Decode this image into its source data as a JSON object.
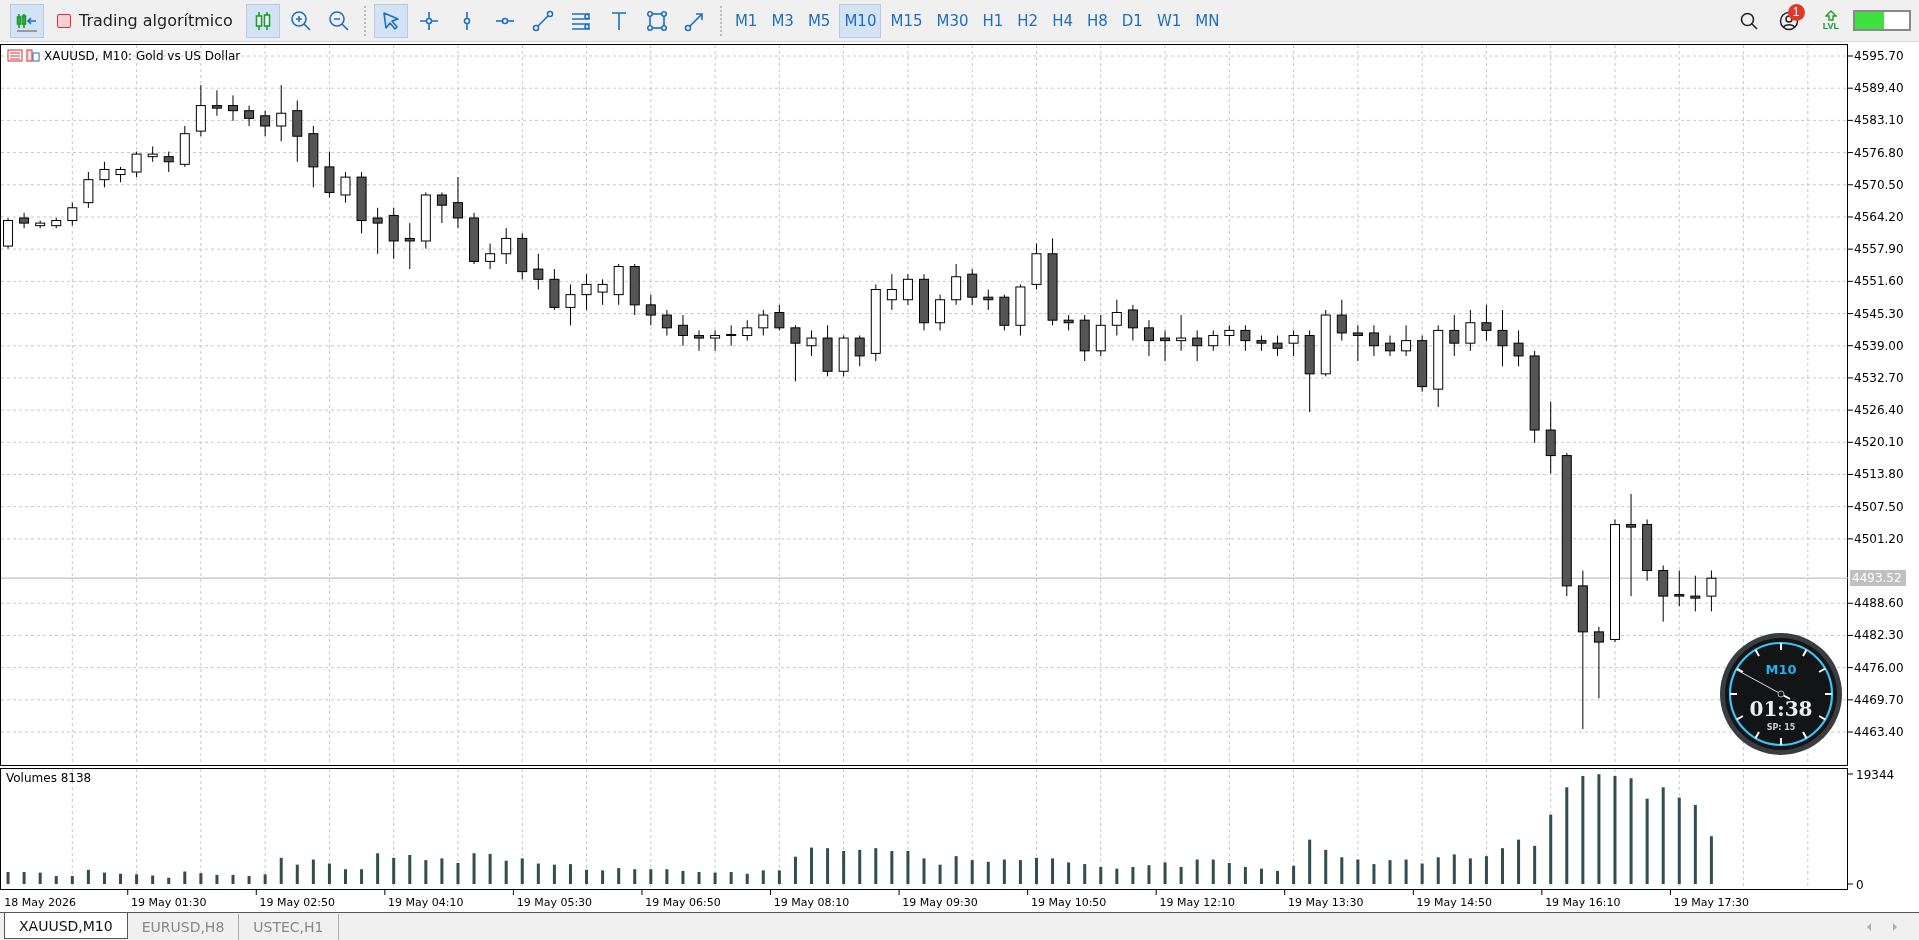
{
  "toolbar": {
    "tool_groups": [
      [
        {
          "kind": "shift",
          "selected": true
        },
        {
          "kind": "algo",
          "label": "Trading algorítmico",
          "on": false,
          "selected": false
        },
        {
          "kind": "candles",
          "selected": true
        },
        {
          "kind": "zoom-in",
          "selected": false
        },
        {
          "kind": "zoom-out",
          "selected": false
        }
      ],
      [
        {
          "kind": "cursor",
          "selected": true
        },
        {
          "kind": "crosshair",
          "selected": false
        },
        {
          "kind": "vline",
          "selected": false
        },
        {
          "kind": "hline",
          "selected": false
        },
        {
          "kind": "trendline",
          "selected": false
        },
        {
          "kind": "channels",
          "selected": false
        },
        {
          "kind": "text",
          "selected": false
        },
        {
          "kind": "rectangle",
          "selected": false
        },
        {
          "kind": "arrow",
          "selected": false
        }
      ]
    ],
    "timeframes": [
      {
        "label": "M1",
        "selected": false
      },
      {
        "label": "M3",
        "selected": false
      },
      {
        "label": "M5",
        "selected": false
      },
      {
        "label": "M10",
        "selected": true
      },
      {
        "label": "M15",
        "selected": false
      },
      {
        "label": "M30",
        "selected": false
      },
      {
        "label": "H1",
        "selected": false
      },
      {
        "label": "H2",
        "selected": false
      },
      {
        "label": "H4",
        "selected": false
      },
      {
        "label": "H8",
        "selected": false
      },
      {
        "label": "D1",
        "selected": false
      },
      {
        "label": "W1",
        "selected": false
      },
      {
        "label": "MN",
        "selected": false
      }
    ],
    "notifications_badge": "1",
    "level_indicator": {
      "label": "LVL",
      "level": 0.53
    }
  },
  "chart": {
    "title": "XAUUSD, M10: Gold vs US Dollar",
    "clock": {
      "timeframe": "M10",
      "countdown": "01:38",
      "spread": "SP: 15"
    },
    "chart_data": {
      "type": "candlestick",
      "grid": true,
      "ref_lines": [
        {
          "axis": "y",
          "value": 4493.52,
          "label": "4493.52"
        }
      ],
      "ylim": [
        4456.75,
        4598.05
      ],
      "yticks": [
        {
          "value": 4595.7,
          "label": "4595.70"
        },
        {
          "value": 4589.4,
          "label": "4589.40"
        },
        {
          "value": 4583.1,
          "label": "4583.10"
        },
        {
          "value": 4576.8,
          "label": "4576.80"
        },
        {
          "value": 4570.5,
          "label": "4570.50"
        },
        {
          "value": 4564.2,
          "label": "4564.20"
        },
        {
          "value": 4557.9,
          "label": "4557.90"
        },
        {
          "value": 4551.6,
          "label": "4551.60"
        },
        {
          "value": 4545.3,
          "label": "4545.30"
        },
        {
          "value": 4539.0,
          "label": "4539.00"
        },
        {
          "value": 4532.7,
          "label": "4532.70"
        },
        {
          "value": 4526.4,
          "label": "4526.40"
        },
        {
          "value": 4520.1,
          "label": "4520.10"
        },
        {
          "value": 4513.8,
          "label": "4513.80"
        },
        {
          "value": 4507.5,
          "label": "4507.50"
        },
        {
          "value": 4501.2,
          "label": "4501.20"
        },
        {
          "value": 4488.6,
          "label": "4488.60"
        },
        {
          "value": 4482.3,
          "label": "4482.30"
        },
        {
          "value": 4476.0,
          "label": "4476.00"
        },
        {
          "value": 4469.7,
          "label": "4469.70"
        },
        {
          "value": 4463.4,
          "label": "4463.40"
        }
      ],
      "categories": [
        null,
        null,
        null,
        null,
        null,
        null,
        null,
        null,
        null,
        null,
        null,
        null,
        null,
        null,
        null,
        null,
        null,
        null,
        null,
        null,
        null,
        null,
        null,
        null,
        null,
        null,
        null,
        null,
        null,
        null,
        null,
        null,
        null,
        null,
        null,
        null,
        null,
        null,
        null,
        null,
        null,
        null,
        null,
        null,
        null,
        null,
        null,
        null,
        null,
        null,
        null,
        null,
        null,
        null,
        null,
        null,
        null,
        null,
        null,
        null,
        null,
        null,
        null,
        null,
        null,
        null,
        null,
        null,
        null,
        null,
        null,
        null,
        null,
        null,
        null,
        null,
        null,
        null,
        null,
        null,
        null,
        null,
        null,
        null,
        null,
        null,
        null,
        null,
        null,
        null,
        null,
        null,
        null,
        null,
        null,
        null,
        null,
        null,
        null,
        null,
        null,
        null,
        null,
        null,
        null,
        null,
        null,
        null,
        null,
        null,
        null,
        null,
        null,
        null,
        null
      ],
      "ohlc": [
        [
          4558.5,
          4564,
          4558,
          4563.5
        ],
        [
          4564,
          4565,
          4562,
          4563
        ],
        [
          4562.5,
          4563.5,
          4562,
          4563
        ],
        [
          4562.5,
          4564,
          4562,
          4563.5
        ],
        [
          4563.5,
          4567,
          4562.5,
          4566
        ],
        [
          4567,
          4573,
          4566,
          4571.5
        ],
        [
          4571.5,
          4575,
          4570,
          4573.5
        ],
        [
          4572.5,
          4574,
          4571,
          4573.5
        ],
        [
          4573,
          4577,
          4572,
          4576.5
        ],
        [
          4576,
          4578,
          4575,
          4576.5
        ],
        [
          4576,
          4577,
          4573,
          4575
        ],
        [
          4574.5,
          4582,
          4574,
          4580.5
        ],
        [
          4581,
          4590,
          4580,
          4586
        ],
        [
          4586,
          4589,
          4584,
          4585.5
        ],
        [
          4586,
          4588,
          4583,
          4585
        ],
        [
          4585,
          4586,
          4582,
          4583.5
        ],
        [
          4584,
          4585,
          4580,
          4582
        ],
        [
          4582,
          4590,
          4579,
          4584.5
        ],
        [
          4585,
          4587,
          4575,
          4580
        ],
        [
          4580.5,
          4582,
          4570,
          4574
        ],
        [
          4574,
          4577,
          4568,
          4569
        ],
        [
          4568.5,
          4573,
          4567,
          4572
        ],
        [
          4572,
          4573,
          4561,
          4563.5
        ],
        [
          4564,
          4566,
          4557,
          4563
        ],
        [
          4564.5,
          4566,
          4556,
          4559.5
        ],
        [
          4560,
          4563,
          4554,
          4559.5
        ],
        [
          4559.5,
          4569,
          4558,
          4568.5
        ],
        [
          4568.5,
          4569,
          4563,
          4566.5
        ],
        [
          4567,
          4572,
          4562,
          4564
        ],
        [
          4564,
          4565,
          4555,
          4555.5
        ],
        [
          4555.5,
          4559,
          4554,
          4557
        ],
        [
          4557,
          4562,
          4555,
          4560
        ],
        [
          4560,
          4561,
          4552,
          4553.5
        ],
        [
          4554,
          4557,
          4550,
          4552
        ],
        [
          4552,
          4554,
          4546,
          4546.5
        ],
        [
          4546.5,
          4551,
          4543,
          4549
        ],
        [
          4549,
          4553,
          4546,
          4551
        ],
        [
          4549.5,
          4552,
          4547,
          4551
        ],
        [
          4549,
          4555,
          4547,
          4554.5
        ],
        [
          4554.5,
          4555,
          4545,
          4547
        ],
        [
          4547,
          4549,
          4543,
          4545
        ],
        [
          4545,
          4546,
          4541,
          4542.5
        ],
        [
          4543,
          4545,
          4539,
          4541
        ],
        [
          4541,
          4542,
          4538,
          4540.5
        ],
        [
          4540.5,
          4542,
          4538,
          4541
        ],
        [
          4541,
          4543,
          4539,
          4541.2
        ],
        [
          4541,
          4544,
          4540,
          4542.5
        ],
        [
          4542.5,
          4546,
          4541,
          4545
        ],
        [
          4545.5,
          4547,
          4542,
          4542.5
        ],
        [
          4542.5,
          4543,
          4532,
          4539.5
        ],
        [
          4539,
          4542,
          4537,
          4540.5
        ],
        [
          4540.5,
          4543,
          4533,
          4534
        ],
        [
          4534,
          4541,
          4533,
          4540.5
        ],
        [
          4540.5,
          4541,
          4535,
          4537
        ],
        [
          4537.5,
          4551,
          4536,
          4550
        ],
        [
          4548,
          4553,
          4546,
          4550
        ],
        [
          4548,
          4553,
          4547,
          4552
        ],
        [
          4552,
          4553,
          4542,
          4543.5
        ],
        [
          4543.5,
          4549,
          4542,
          4548
        ],
        [
          4548,
          4555,
          4547,
          4552.5
        ],
        [
          4553,
          4554,
          4547,
          4548.5
        ],
        [
          4548.5,
          4550,
          4546,
          4548
        ],
        [
          4548.5,
          4549,
          4542,
          4543
        ],
        [
          4543,
          4551,
          4541,
          4550.5
        ],
        [
          4551,
          4559,
          4550,
          4557
        ],
        [
          4557,
          4560,
          4543,
          4544
        ],
        [
          4544,
          4545,
          4542,
          4543.5
        ],
        [
          4544,
          4545,
          4536,
          4538
        ],
        [
          4538,
          4545,
          4537,
          4543
        ],
        [
          4543,
          4548,
          4541,
          4545.5
        ],
        [
          4546,
          4547,
          4540,
          4542.5
        ],
        [
          4542.5,
          4544,
          4537,
          4540
        ],
        [
          4540.5,
          4542,
          4536,
          4540
        ],
        [
          4540,
          4545,
          4538,
          4540.5
        ],
        [
          4540.5,
          4542,
          4536,
          4539
        ],
        [
          4539,
          4542,
          4538,
          4541
        ],
        [
          4541,
          4543,
          4539,
          4542
        ],
        [
          4542,
          4543,
          4538,
          4540
        ],
        [
          4540,
          4541,
          4538,
          4539.5
        ],
        [
          4539.5,
          4541,
          4537,
          4538.5
        ],
        [
          4539.5,
          4542,
          4537,
          4541
        ],
        [
          4541,
          4542,
          4526,
          4533.5
        ],
        [
          4533.5,
          4546,
          4533,
          4545
        ],
        [
          4545,
          4548,
          4540,
          4541.5
        ],
        [
          4541.5,
          4543,
          4536,
          4541
        ],
        [
          4541.5,
          4543,
          4537,
          4539
        ],
        [
          4539.5,
          4541,
          4537,
          4538
        ],
        [
          4538,
          4543,
          4537,
          4540
        ],
        [
          4540,
          4541,
          4530,
          4531
        ],
        [
          4530.5,
          4543,
          4527,
          4542
        ],
        [
          4542,
          4545,
          4537,
          4539.5
        ],
        [
          4539.5,
          4546,
          4538,
          4543.5
        ],
        [
          4543.5,
          4547,
          4540,
          4542
        ],
        [
          4542,
          4546,
          4535,
          4539
        ],
        [
          4539.5,
          4542,
          4535,
          4537
        ],
        [
          4537,
          4538,
          4520,
          4522.5
        ],
        [
          4522.5,
          4528,
          4514,
          4517.5
        ],
        [
          4517.5,
          4518,
          4490,
          4492
        ],
        [
          4492,
          4495,
          4464,
          4483
        ],
        [
          4483,
          4484,
          4470,
          4481
        ],
        [
          4481.5,
          4505,
          4481,
          4504
        ],
        [
          4504,
          4510,
          4490,
          4503.5
        ],
        [
          4504,
          4505,
          4493,
          4495
        ],
        [
          4495,
          4496,
          4485,
          4490
        ],
        [
          4490.3,
          4495,
          4488,
          4490
        ],
        [
          4490,
          4494,
          4487,
          4489.6
        ],
        [
          4490,
          4495,
          4487,
          4493.5
        ],
        null,
        null,
        null,
        null,
        null,
        null,
        null,
        null
      ]
    }
  },
  "volumes": {
    "label": "Volumes 8138",
    "chart_data": {
      "type": "bar",
      "grid": true,
      "ylim": [
        0,
        19344
      ],
      "yticks": [
        {
          "value": 19344,
          "label": "19344"
        },
        {
          "value": 0,
          "label": "0"
        }
      ],
      "categories": [
        null,
        null,
        "18 May 2026",
        null,
        null,
        null,
        null,
        null,
        null,
        null,
        "19 May 01:30",
        null,
        null,
        null,
        null,
        null,
        null,
        null,
        "19 May 02:50",
        null,
        null,
        null,
        null,
        null,
        null,
        null,
        "19 May 04:10",
        null,
        null,
        null,
        null,
        null,
        null,
        null,
        "19 May 05:30",
        null,
        null,
        null,
        null,
        null,
        null,
        null,
        "19 May 06:50",
        null,
        null,
        null,
        null,
        null,
        null,
        null,
        "19 May 08:10",
        null,
        null,
        null,
        null,
        null,
        null,
        null,
        "19 May 09:30",
        null,
        null,
        null,
        null,
        null,
        null,
        null,
        "19 May 10:50",
        null,
        null,
        null,
        null,
        null,
        null,
        null,
        "19 May 12:10",
        null,
        null,
        null,
        null,
        null,
        null,
        null,
        "19 May 13:30",
        null,
        null,
        null,
        null,
        null,
        null,
        null,
        "19 May 14:50",
        null,
        null,
        null,
        null,
        null,
        null,
        null,
        "19 May 16:10",
        null,
        null,
        null,
        null,
        null,
        null,
        null,
        "19 May 17:30",
        null,
        null,
        null,
        null,
        null,
        null,
        null,
        null
      ],
      "values": [
        2100,
        2100,
        2000,
        1400,
        1400,
        2500,
        2000,
        1800,
        1700,
        1500,
        1100,
        2200,
        1900,
        1600,
        1600,
        1400,
        1700,
        4600,
        3400,
        4300,
        3600,
        2600,
        2600,
        5400,
        4600,
        5100,
        4200,
        4500,
        3700,
        5400,
        5300,
        4100,
        4500,
        3600,
        3400,
        3500,
        2500,
        2400,
        2800,
        2600,
        2600,
        2600,
        2300,
        2100,
        2000,
        2100,
        1800,
        2400,
        2400,
        4800,
        6400,
        6300,
        5800,
        6000,
        6300,
        5800,
        5800,
        4500,
        3400,
        4900,
        4200,
        3900,
        4300,
        4200,
        4600,
        4500,
        3800,
        3500,
        3000,
        2700,
        3000,
        3300,
        3800,
        3000,
        4300,
        4300,
        3700,
        3000,
        2700,
        2300,
        3200,
        7800,
        6000,
        4700,
        4300,
        3500,
        4200,
        4300,
        3600,
        4700,
        5200,
        4500,
        4900,
        6300,
        7800,
        6700,
        12200,
        17000,
        19000,
        19300,
        19000,
        18600,
        15000,
        17000,
        15200,
        13900,
        8400,
        null,
        null,
        null,
        null,
        null,
        null,
        null,
        null
      ]
    }
  },
  "tabs": [
    {
      "label": "XAUUSD,M10",
      "selected": true
    },
    {
      "label": "EURUSD,H8",
      "selected": false
    },
    {
      "label": "USTEC,H1",
      "selected": false
    }
  ]
}
